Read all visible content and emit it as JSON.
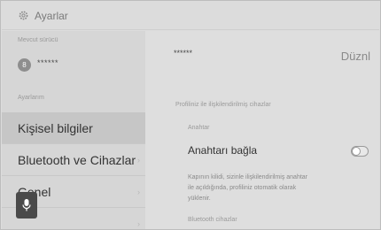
{
  "header": {
    "title": "Ayarlar",
    "icon": "gear-icon"
  },
  "sidebar": {
    "current_driver_label": "Mevcut sürücü",
    "driver": {
      "avatar_initial": "8",
      "name": "******"
    },
    "settings_label": "Ayarlarım",
    "items": [
      {
        "label": "Kişisel bilgiler",
        "active": true
      },
      {
        "label": "Bluetooth ve Cihazlar",
        "active": false
      },
      {
        "label": "Genel",
        "active": false
      }
    ]
  },
  "panel": {
    "user_mask": "******",
    "edit_label": "Düznl",
    "profile_devices_label": "Profiliniz ile ilişkilendirilmiş cihazlar",
    "key_section_label": "Anahtar",
    "connect_key_label": "Anahtarı bağla",
    "toggle_on": false,
    "description_lines": [
      "Kapının kilidi, sizinle ilişkilendirilmiş anahtar",
      "ile açıldığında, profiliniz otomatik olarak",
      "yüklenir."
    ],
    "bluetooth_devices_label": "Bluetooth cihazlar"
  },
  "mic": {
    "icon": "microphone-icon"
  },
  "colors": {
    "background": "#dcdcdc",
    "active_row": "#c6c6c6",
    "mic_button": "#4a4a4a"
  }
}
